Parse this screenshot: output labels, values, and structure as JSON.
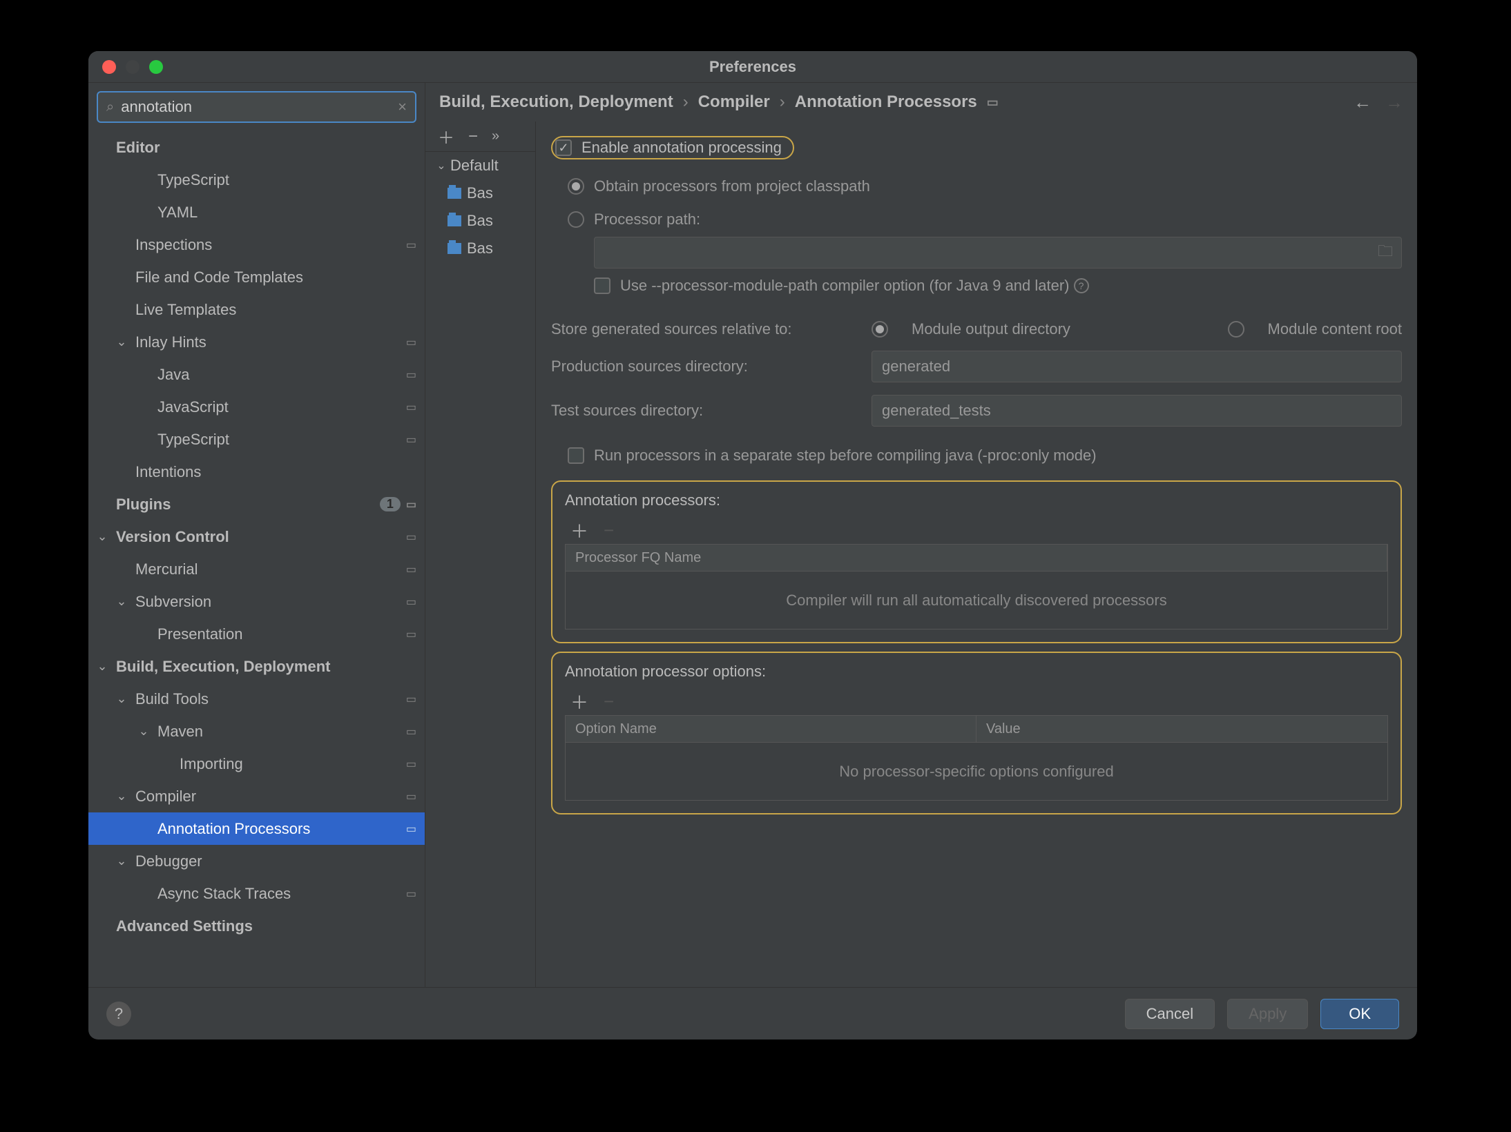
{
  "title": "Preferences",
  "search": {
    "value": "annotation"
  },
  "tree": {
    "editor": {
      "label": "Editor",
      "children": {
        "typescript": "TypeScript",
        "yaml": "YAML",
        "inspections": "Inspections",
        "file_code_templates": "File and Code Templates",
        "live_templates": "Live Templates",
        "inlay_hints": {
          "label": "Inlay Hints",
          "children": {
            "java": "Java",
            "javascript": "JavaScript",
            "typescript2": "TypeScript"
          }
        },
        "intentions": "Intentions"
      }
    },
    "plugins": {
      "label": "Plugins",
      "badge": "1"
    },
    "version_control": {
      "label": "Version Control",
      "children": {
        "mercurial": "Mercurial",
        "subversion": {
          "label": "Subversion",
          "children": {
            "presentation": "Presentation"
          }
        }
      }
    },
    "bed": {
      "label": "Build, Execution, Deployment",
      "children": {
        "build_tools": {
          "label": "Build Tools",
          "children": {
            "maven": {
              "label": "Maven",
              "children": {
                "importing": "Importing"
              }
            }
          }
        },
        "compiler": {
          "label": "Compiler",
          "children": {
            "annotation_processors": "Annotation Processors"
          }
        },
        "debugger": {
          "label": "Debugger",
          "children": {
            "async": "Async Stack Traces"
          }
        }
      }
    },
    "advanced": "Advanced Settings"
  },
  "breadcrumb": {
    "a": "Build, Execution, Deployment",
    "b": "Compiler",
    "c": "Annotation Processors"
  },
  "profiles": {
    "header": "Default",
    "modules": [
      "Bas",
      "Bas",
      "Bas"
    ]
  },
  "settings": {
    "enable": "Enable annotation processing",
    "obtain": "Obtain processors from project classpath",
    "ppath": "Processor path:",
    "module_path": "Use --processor-module-path compiler option (for Java 9 and later)",
    "store_label": "Store generated sources relative to:",
    "store_opt1": "Module output directory",
    "store_opt2": "Module content root",
    "prod_label": "Production sources directory:",
    "prod_value": "generated",
    "test_label": "Test sources directory:",
    "test_value": "generated_tests",
    "sep_step": "Run processors in a separate step before compiling java (-proc:only mode)",
    "ap_label": "Annotation processors:",
    "ap_col": "Processor FQ Name",
    "ap_empty": "Compiler will run all automatically discovered processors",
    "opt_label": "Annotation processor options:",
    "opt_col1": "Option Name",
    "opt_col2": "Value",
    "opt_empty": "No processor-specific options configured"
  },
  "buttons": {
    "cancel": "Cancel",
    "apply": "Apply",
    "ok": "OK"
  }
}
